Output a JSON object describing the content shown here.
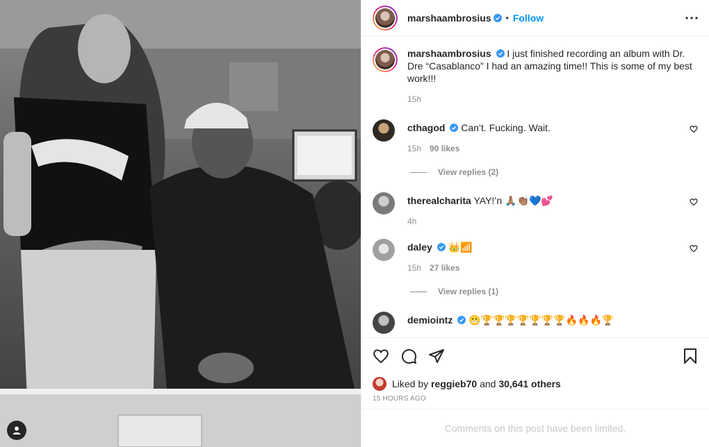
{
  "post": {
    "author": "marshaambrosius",
    "follow_label": "Follow",
    "dot": "•",
    "caption": "I just finished recording an album with Dr. Dre “Casablanco” I had an amazing time!! This is some of my best work!!!",
    "caption_time": "15h"
  },
  "comments": [
    {
      "user": "cthagod",
      "verified": true,
      "text": "Can’t. Fucking. Wait.",
      "time": "15h",
      "likes": "90 likes",
      "replies": "View replies (2)"
    },
    {
      "user": "therealcharita",
      "verified": false,
      "text": "YAY!’n 🙏🏽👏🏽💙💕",
      "time": "4h",
      "likes": "",
      "replies": ""
    },
    {
      "user": "daley",
      "verified": true,
      "text": "👑📶",
      "time": "15h",
      "likes": "27 likes",
      "replies": "View replies (1)"
    },
    {
      "user": "demiointz",
      "verified": true,
      "text": "😬🏆🏆🏆🏆🏆🏆🏆🔥🔥🔥🏆",
      "time": "",
      "likes": "",
      "replies": ""
    }
  ],
  "actions": {
    "liked_by_prefix": "Liked by",
    "liked_by_user": "reggieb70",
    "liked_by_and": "and",
    "liked_by_count": "30,641 others",
    "timestamp": "15 HOURS AGO",
    "comments_limited": "Comments on this post have been limited."
  },
  "icons": {
    "like": "heart-icon",
    "comment": "comment-icon",
    "share": "share-icon",
    "save": "bookmark-icon",
    "more": "more-horizontal-icon",
    "verified": "verified-badge-icon",
    "tagged": "user-tag-icon"
  },
  "colors": {
    "link_blue": "#0095f6",
    "verified_blue": "#3897f0",
    "muted": "#8e8e8e",
    "border": "#efefef"
  }
}
